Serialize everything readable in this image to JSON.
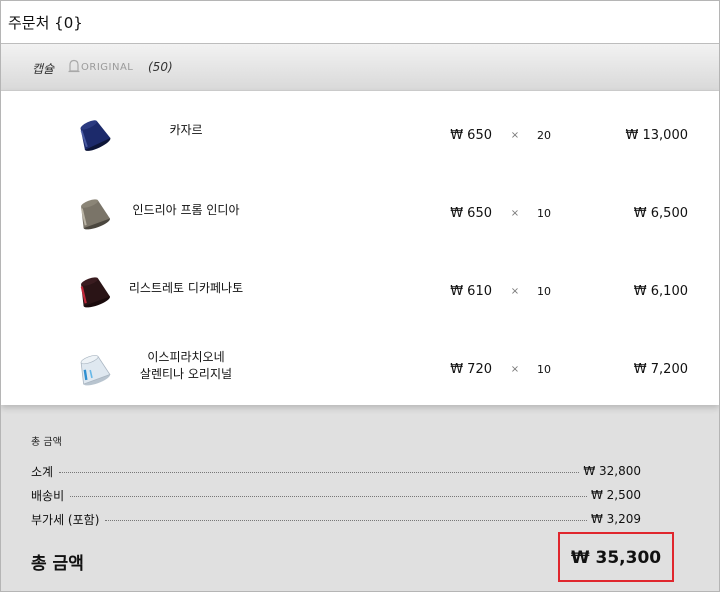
{
  "header": {
    "title": "주문처 {0}"
  },
  "category_bar": {
    "category": "캡슐",
    "brand": "ORIGINAL",
    "brand_icon": "bell-icon",
    "count": "(50)"
  },
  "items": [
    {
      "name": "카자르",
      "price": "₩ 650",
      "times": "×",
      "quantity": "20",
      "line_total": "₩ 13,000",
      "capsule_color": "#1c2a6b"
    },
    {
      "name": "인드리아 프롬 인디아",
      "price": "₩ 650",
      "times": "×",
      "quantity": "10",
      "line_total": "₩ 6,500",
      "capsule_color": "#7a7468"
    },
    {
      "name": "리스트레토 디카페나토",
      "price": "₩ 610",
      "times": "×",
      "quantity": "10",
      "line_total": "₩ 6,100",
      "capsule_color": "#2a1416"
    },
    {
      "name_line1": "이스피라치오네",
      "name_line2": "살렌티나 오리지널",
      "price": "₩ 720",
      "times": "×",
      "quantity": "10",
      "line_total": "₩ 7,200",
      "capsule_color": "#dfe8f0"
    }
  ],
  "summary": {
    "caption": "총 금액",
    "subtotal_label": "소계",
    "subtotal": "₩ 32,800",
    "shipping_label": "배송비",
    "shipping": "₩ 2,500",
    "vat_label": "부가세 (포함)",
    "vat": "₩ 3,209",
    "grand_total_label": "총 금액",
    "grand_total": "₩ 35,300",
    "highlight_color": "#e0262d"
  }
}
